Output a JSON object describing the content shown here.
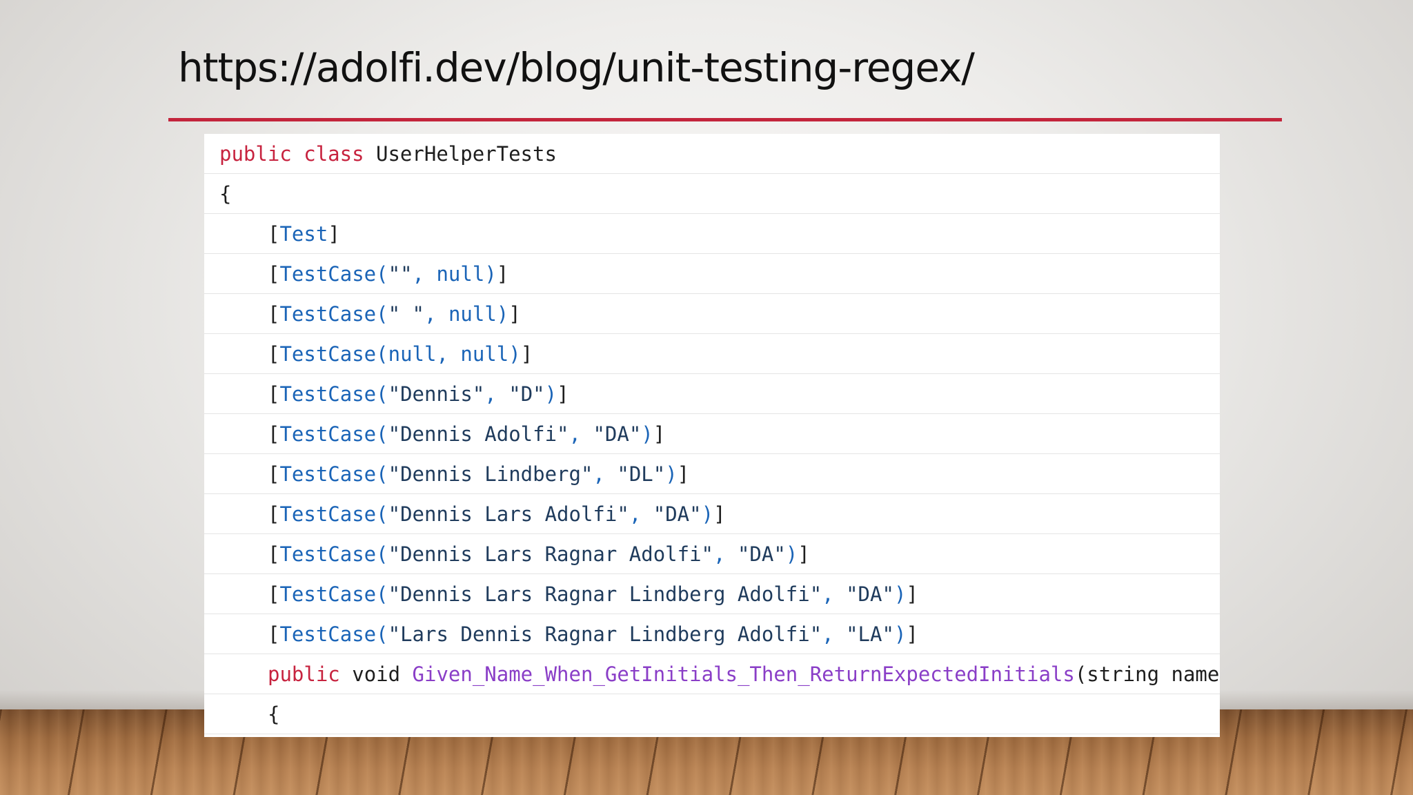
{
  "slide": {
    "title": "https://adolfi.dev/blog/unit-testing-regex/"
  },
  "code": {
    "line1": {
      "kw1": "public",
      "kw2": "class",
      "name": "UserHelperTests"
    },
    "line2": {
      "text": "{"
    },
    "line3": {
      "open": "[",
      "attr": "Test",
      "close": "]"
    },
    "line4": {
      "open": "[",
      "attr": "TestCase(",
      "a1": "\"\"",
      "sep": ",",
      "a2": "null",
      "attr_close": ")",
      "close": "]"
    },
    "line5": {
      "open": "[",
      "attr": "TestCase(",
      "a1": "\" \"",
      "sep": ",",
      "a2": "null",
      "attr_close": ")",
      "close": "]"
    },
    "line6": {
      "open": "[",
      "attr": "TestCase(null",
      "sep": ",",
      "a2": "null",
      "attr_close": ")",
      "close": "]"
    },
    "line7": {
      "open": "[",
      "attr": "TestCase(",
      "a1": "\"Dennis\"",
      "sep": ",",
      "a2": "\"D\"",
      "attr_close": ")",
      "close": "]"
    },
    "line8": {
      "open": "[",
      "attr": "TestCase(",
      "a1": "\"Dennis Adolfi\"",
      "sep": ",",
      "a2": "\"DA\"",
      "attr_close": ")",
      "close": "]"
    },
    "line9": {
      "open": "[",
      "attr": "TestCase(",
      "a1": "\"Dennis Lindberg\"",
      "sep": ",",
      "a2": "\"DL\"",
      "attr_close": ")",
      "close": "]"
    },
    "line10": {
      "open": "[",
      "attr": "TestCase(",
      "a1": "\"Dennis Lars Adolfi\"",
      "sep": ",",
      "a2": "\"DA\"",
      "attr_close": ")",
      "close": "]"
    },
    "line11": {
      "open": "[",
      "attr": "TestCase(",
      "a1": "\"Dennis Lars Ragnar Adolfi\"",
      "sep": ",",
      "a2": "\"DA\"",
      "attr_close": ")",
      "close": "]"
    },
    "line12": {
      "open": "[",
      "attr": "TestCase(",
      "a1": "\"Dennis Lars Ragnar Lindberg Adolfi\"",
      "sep": ",",
      "a2": "\"DA\"",
      "attr_close": ")",
      "close": "]"
    },
    "line13": {
      "open": "[",
      "attr": "TestCase(",
      "a1": "\"Lars Dennis Ragnar Lindberg Adolfi\"",
      "sep": ",",
      "a2": "\"LA\"",
      "attr_close": ")",
      "close": "]"
    },
    "line14": {
      "kw": "public",
      "type": "void",
      "method": "Given_Name_When_GetInitials_Then_ReturnExpectedInitials",
      "params": "(string name,"
    },
    "line15": {
      "text": "{"
    }
  },
  "colors": {
    "keyword": "#c7233f",
    "attribute": "#1a64b7",
    "method": "#8a3ec7",
    "rule": "#c3253c"
  }
}
